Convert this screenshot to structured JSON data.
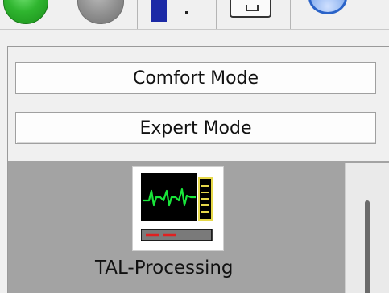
{
  "toolbar": {
    "icons": [
      "start-icon",
      "stop-icon",
      "level-bar-icon",
      "document-icon",
      "globe-icon"
    ],
    "accent_green": "#2fb52f",
    "accent_blue": "#1c2aa6"
  },
  "modes": {
    "comfort_label": "Comfort Mode",
    "expert_label": "Expert Mode"
  },
  "modules": {
    "items": [
      {
        "label": "TAL-Processing",
        "icon": "monitor-waveform-icon"
      }
    ]
  },
  "colors": {
    "list_background": "#a3a3a3",
    "panel_background": "#f0f0f0",
    "waveform": "#19e63a",
    "level_meter": "#e6d84a",
    "indicator": "#e02020"
  }
}
